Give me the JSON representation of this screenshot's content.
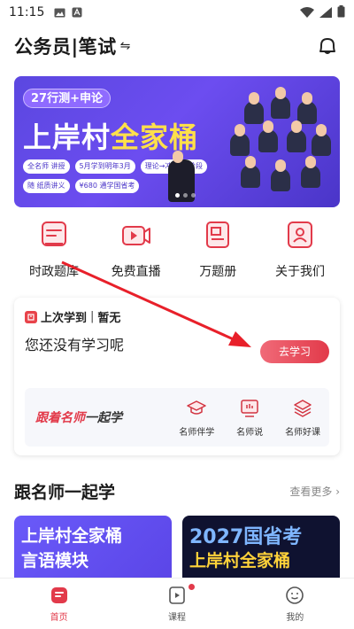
{
  "status_bar": {
    "time": "11:15"
  },
  "header": {
    "title": "公务员|笔试",
    "switch_glyph": "⇋"
  },
  "banner": {
    "subtitle": "27行测+申论",
    "title_white": "上岸村",
    "title_highlight": "全家桶",
    "chips": [
      "全名师 讲授",
      "5月学到明年3月",
      "理论→冲刺 全阶段",
      "随 纸质讲义",
      "¥680 通学国省考"
    ],
    "dots": 3,
    "active_dot": 0
  },
  "quick_nav": [
    {
      "label": "时政题库",
      "icon": "question-bank-icon"
    },
    {
      "label": "免费直播",
      "icon": "live-video-icon"
    },
    {
      "label": "万题册",
      "icon": "exercise-book-icon"
    },
    {
      "label": "关于我们",
      "icon": "about-us-icon"
    }
  ],
  "study": {
    "last_label": "上次学到",
    "last_value": "暂无",
    "empty_message": "您还没有学习呢",
    "go_button": "去学习"
  },
  "teacher_bar": {
    "slogan_red": "跟着名师",
    "slogan_dark": "一起学",
    "items": [
      {
        "label": "名师伴学",
        "icon": "graduation-cap-icon"
      },
      {
        "label": "名师说",
        "icon": "screen-talk-icon"
      },
      {
        "label": "名师好课",
        "icon": "layers-icon"
      }
    ]
  },
  "section": {
    "title": "跟名师一起学",
    "more": "查看更多 ›"
  },
  "courses": [
    {
      "line1": "上岸村全家桶",
      "line2": "言语模块"
    },
    {
      "line1": "2027国省考",
      "line2": "上岸村全家桶"
    }
  ],
  "tabs": [
    {
      "label": "首页",
      "icon": "home-icon",
      "active": true
    },
    {
      "label": "课程",
      "icon": "course-icon",
      "active": false,
      "badge": true
    },
    {
      "label": "我的",
      "icon": "profile-icon",
      "active": false
    }
  ],
  "colors": {
    "accent": "#e23a4a",
    "banner": "#5b47e0",
    "highlight": "#ffe04a"
  }
}
